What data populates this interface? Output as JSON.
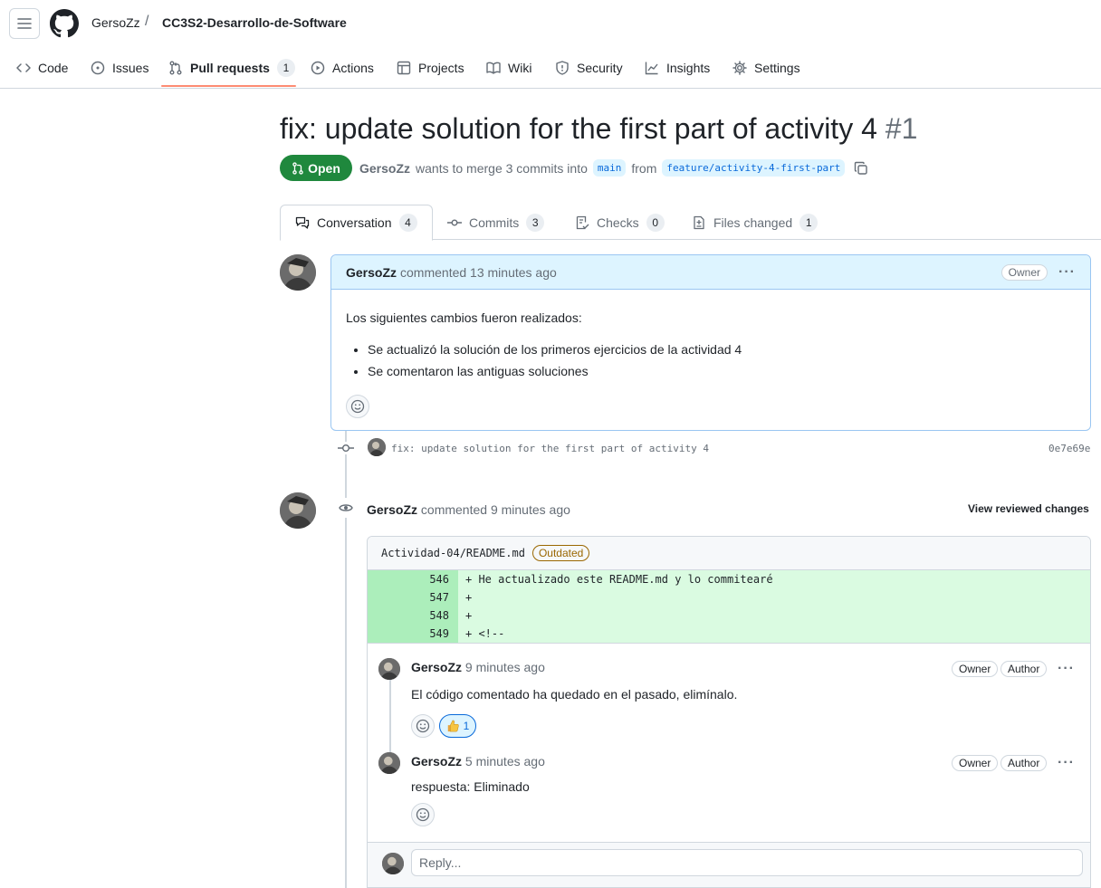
{
  "header": {
    "owner": "GersoZz",
    "separator": "/",
    "repo": "CC3S2-Desarrollo-de-Software"
  },
  "repo_tabs": [
    {
      "label": "Code",
      "icon": "code-icon"
    },
    {
      "label": "Issues",
      "icon": "issue-icon"
    },
    {
      "label": "Pull requests",
      "icon": "pull-request-icon",
      "count": "1"
    },
    {
      "label": "Actions",
      "icon": "play-icon"
    },
    {
      "label": "Projects",
      "icon": "table-icon"
    },
    {
      "label": "Wiki",
      "icon": "book-icon"
    },
    {
      "label": "Security",
      "icon": "shield-icon"
    },
    {
      "label": "Insights",
      "icon": "graph-icon"
    },
    {
      "label": "Settings",
      "icon": "gear-icon"
    }
  ],
  "pr": {
    "title": "fix: update solution for the first part of activity 4",
    "number": "#1",
    "state": "Open",
    "author": "GersoZz",
    "merge_text": "wants to merge 3 commits into",
    "base": "main",
    "from": "from",
    "head": "feature/activity-4-first-part"
  },
  "pr_tabs": [
    {
      "label": "Conversation",
      "count": "4"
    },
    {
      "label": "Commits",
      "count": "3"
    },
    {
      "label": "Checks",
      "count": "0"
    },
    {
      "label": "Files changed",
      "count": "1"
    }
  ],
  "first_comment": {
    "author": "GersoZz",
    "action": "commented 13 minutes ago",
    "badge": "Owner",
    "intro": "Los siguientes cambios fueron realizados:",
    "bullets": [
      "Se actualizó la solución de los primeros ejercicios de la actividad 4",
      "Se comentaron las antiguas soluciones"
    ]
  },
  "commit": {
    "message": "fix: update solution for the first part of activity 4",
    "sha": "0e7e69e"
  },
  "review": {
    "author": "GersoZz",
    "action": "commented 9 minutes ago",
    "view_link": "View reviewed changes",
    "file": "Actividad-04/README.md",
    "file_badge": "Outdated",
    "diff": [
      {
        "line": "546",
        "code": "+ He actualizado este README.md y lo commitearé"
      },
      {
        "line": "547",
        "code": "+"
      },
      {
        "line": "548",
        "code": "+"
      },
      {
        "line": "549",
        "code": "+ <!--"
      }
    ],
    "comments": [
      {
        "author": "GersoZz",
        "time": "9 minutes ago",
        "badges": [
          "Owner",
          "Author"
        ],
        "body": "El código comentado ha quedado en el pasado, elimínalo.",
        "reaction_count": "1"
      },
      {
        "author": "GersoZz",
        "time": "5 minutes ago",
        "badges": [
          "Owner",
          "Author"
        ],
        "body": "respuesta: Eliminado"
      }
    ],
    "reply_placeholder": "Reply..."
  },
  "colors": {
    "open_green": "#1f883d",
    "accent_blue": "#0969da",
    "diff_add": "#dafbe1",
    "tab_underline": "#fd8c73"
  }
}
